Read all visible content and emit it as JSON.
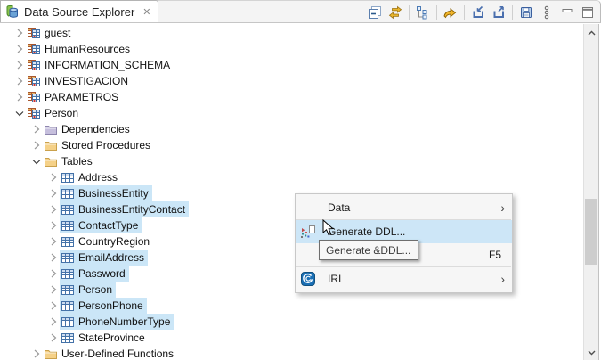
{
  "panel": {
    "title": "Data Source Explorer"
  },
  "toolbar": {
    "buttons": [
      {
        "name": "collapse-windows",
        "icon": "collapsewin"
      },
      {
        "name": "link-with-editor",
        "icon": "linkeditor"
      },
      {
        "type": "separator"
      },
      {
        "name": "collapse-all",
        "icon": "collapsetree"
      },
      {
        "type": "separator"
      },
      {
        "name": "connect",
        "icon": "connect"
      },
      {
        "type": "separator"
      },
      {
        "name": "import-profile",
        "icon": "importp"
      },
      {
        "name": "export-profile",
        "icon": "exportp"
      },
      {
        "type": "separator"
      },
      {
        "name": "save",
        "icon": "save"
      },
      {
        "name": "view-menu",
        "icon": "viewmenu"
      },
      {
        "name": "minimize",
        "icon": "minimize"
      },
      {
        "name": "maximize",
        "icon": "maximize"
      }
    ]
  },
  "tree": {
    "items": [
      {
        "label": "guest",
        "level": 0,
        "icon": "schema",
        "chevron": "collapsed",
        "selected": false
      },
      {
        "label": "HumanResources",
        "level": 0,
        "icon": "schema",
        "chevron": "collapsed",
        "selected": false
      },
      {
        "label": "INFORMATION_SCHEMA",
        "level": 0,
        "icon": "schema",
        "chevron": "collapsed",
        "selected": false
      },
      {
        "label": "INVESTIGACION",
        "level": 0,
        "icon": "schema",
        "chevron": "collapsed",
        "selected": false
      },
      {
        "label": "PARAMETROS",
        "level": 0,
        "icon": "schema",
        "chevron": "collapsed",
        "selected": false
      },
      {
        "label": "Person",
        "level": 0,
        "icon": "schema",
        "chevron": "expanded",
        "selected": false
      },
      {
        "label": "Dependencies",
        "level": 1,
        "icon": "folderpurple",
        "chevron": "collapsed",
        "selected": false
      },
      {
        "label": "Stored Procedures",
        "level": 1,
        "icon": "folder",
        "chevron": "collapsed",
        "selected": false
      },
      {
        "label": "Tables",
        "level": 1,
        "icon": "folder",
        "chevron": "expanded",
        "selected": false
      },
      {
        "label": "Address",
        "level": 2,
        "icon": "table",
        "chevron": "collapsed",
        "selected": false
      },
      {
        "label": "BusinessEntity",
        "level": 2,
        "icon": "table",
        "chevron": "collapsed",
        "selected": true
      },
      {
        "label": "BusinessEntityContact",
        "level": 2,
        "icon": "table",
        "chevron": "collapsed",
        "selected": true
      },
      {
        "label": "ContactType",
        "level": 2,
        "icon": "table",
        "chevron": "collapsed",
        "selected": true
      },
      {
        "label": "CountryRegion",
        "level": 2,
        "icon": "table",
        "chevron": "collapsed",
        "selected": false
      },
      {
        "label": "EmailAddress",
        "level": 2,
        "icon": "table",
        "chevron": "collapsed",
        "selected": true
      },
      {
        "label": "Password",
        "level": 2,
        "icon": "table",
        "chevron": "collapsed",
        "selected": true
      },
      {
        "label": "Person",
        "level": 2,
        "icon": "table",
        "chevron": "collapsed",
        "selected": true
      },
      {
        "label": "PersonPhone",
        "level": 2,
        "icon": "table",
        "chevron": "collapsed",
        "selected": true
      },
      {
        "label": "PhoneNumberType",
        "level": 2,
        "icon": "table",
        "chevron": "collapsed",
        "selected": true
      },
      {
        "label": "StateProvince",
        "level": 2,
        "icon": "table",
        "chevron": "collapsed",
        "selected": false
      },
      {
        "label": "User-Defined Functions",
        "level": 1,
        "icon": "folder",
        "chevron": "collapsed",
        "selected": false
      }
    ]
  },
  "context_menu": {
    "items": [
      {
        "type": "item",
        "name": "menu-item-data",
        "label": "Data",
        "submenu": true
      },
      {
        "type": "separator"
      },
      {
        "type": "item",
        "name": "menu-item-generate-ddl",
        "label": "Generate DDL...",
        "icon": "generateddl",
        "highlighted": true
      },
      {
        "type": "item",
        "name": "menu-item-refresh",
        "label": "",
        "accelerator": "F5"
      },
      {
        "type": "separator"
      },
      {
        "type": "item",
        "name": "menu-item-iri",
        "label": "IRI",
        "icon": "iri",
        "submenu": true
      }
    ]
  },
  "tooltip": {
    "text": "Generate &DDL..."
  },
  "colors": {
    "selection": "#cbe6f7",
    "menu_highlight": "#cde6f7",
    "folder_yellow": "#f5d188",
    "folder_purple": "#c6bfdd",
    "table_blue": "#4472a8",
    "schema_brown": "#a8572f",
    "iri_blue": "#1a6fb5",
    "toolbar_gold": "#e8b52c"
  }
}
